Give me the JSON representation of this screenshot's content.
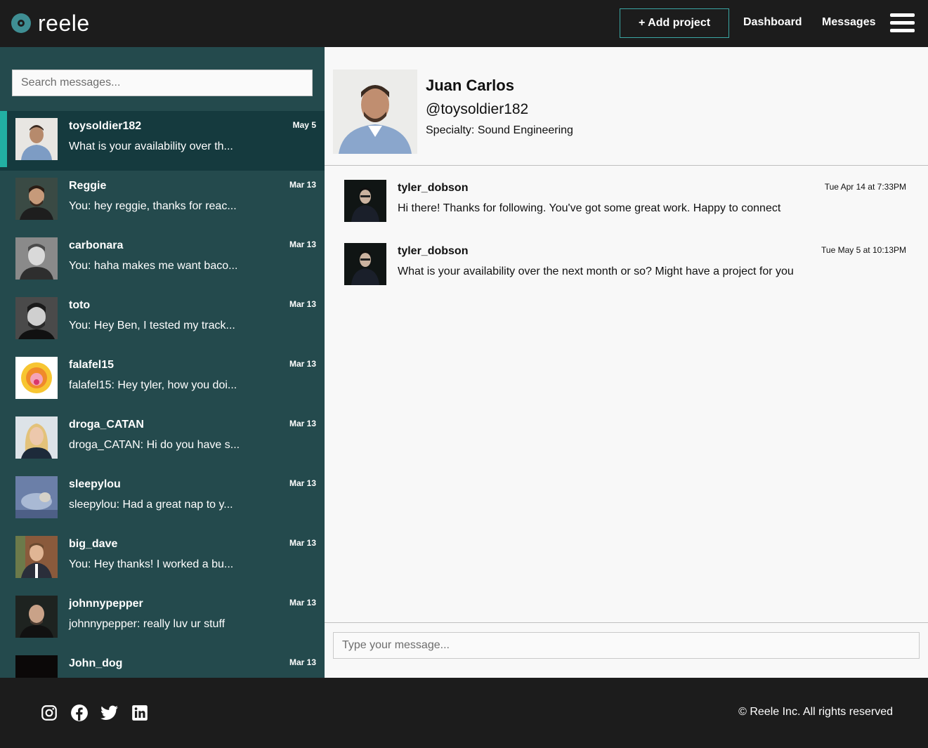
{
  "nav": {
    "brand": "reele",
    "add_project": "+ Add project",
    "dashboard": "Dashboard",
    "messages": "Messages",
    "menu_icon": "hamburger-icon"
  },
  "sidebar": {
    "search_placeholder": "Search messages...",
    "conversations": [
      {
        "name": "toysoldier182",
        "date": "May 5",
        "preview": "What is your availability over th...",
        "active": true
      },
      {
        "name": "Reggie",
        "date": "Mar 13",
        "preview": "You: hey reggie, thanks for reac..."
      },
      {
        "name": "carbonara",
        "date": "Mar 13",
        "preview": "You: haha makes me want baco..."
      },
      {
        "name": "toto",
        "date": "Mar 13",
        "preview": "You: Hey Ben, I tested my track..."
      },
      {
        "name": "falafel15",
        "date": "Mar 13",
        "preview": "falafel15: Hey tyler, how you doi..."
      },
      {
        "name": "droga_CATAN",
        "date": "Mar 13",
        "preview": "droga_CATAN: Hi do you have s..."
      },
      {
        "name": "sleepylou",
        "date": "Mar 13",
        "preview": "sleepylou: Had a great nap to y..."
      },
      {
        "name": "big_dave",
        "date": "Mar 13",
        "preview": "You: Hey thanks! I worked a bu..."
      },
      {
        "name": "johnnypepper",
        "date": "Mar 13",
        "preview": "johnnypepper: really luv ur stuff"
      },
      {
        "name": "John_dog",
        "date": "Mar 13",
        "preview": ""
      }
    ]
  },
  "profile": {
    "name": "Juan Carlos",
    "handle": "@toysoldier182",
    "specialty": "Specialty: Sound Engineering"
  },
  "thread": {
    "messages": [
      {
        "sender": "tyler_dobson",
        "time": "Tue Apr 14 at 7:33PM",
        "text": "Hi there! Thanks for following. You've got some great work. Happy to connect"
      },
      {
        "sender": "tyler_dobson",
        "time": "Tue May 5 at 10:13PM",
        "text": "What is your availability over the next month or so? Might have a project for you"
      }
    ],
    "composer_placeholder": "Type your message..."
  },
  "footer": {
    "social_icons": [
      "instagram-icon",
      "facebook-icon",
      "twitter-icon",
      "linkedin-icon"
    ],
    "copyright": "Reele Inc. All rights reserved"
  },
  "colors": {
    "header_bg": "#1c1c1c",
    "sidebar_bg": "#244a4d",
    "sidebar_active_bg": "#153a3e",
    "accent": "#22b0a3",
    "main_bg": "#f8f8f8"
  }
}
